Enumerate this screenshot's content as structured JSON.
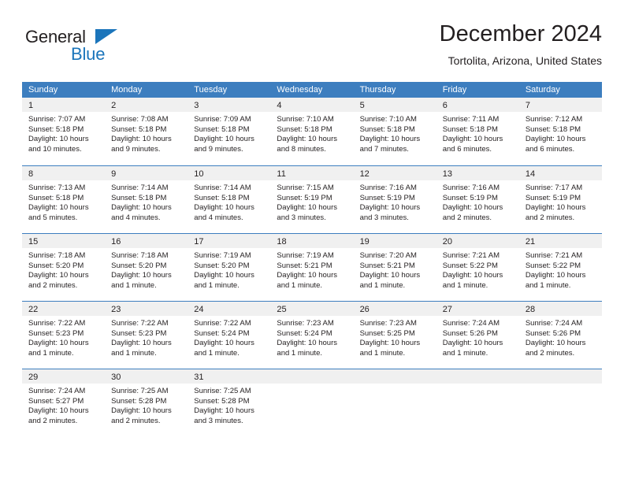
{
  "brand": {
    "name_top": "General",
    "name_bottom": "Blue",
    "triangle_icon": "blue-triangle-logo-icon",
    "color_black": "#231f20",
    "color_blue": "#1b75bb"
  },
  "header": {
    "title": "December 2024",
    "subtitle": "Tortolita, Arizona, United States"
  },
  "theme": {
    "header_bar": "#3d7ebf",
    "day_band": "#f0f0f0",
    "text": "#231f20",
    "background": "#ffffff"
  },
  "calendar": {
    "weekday_headers": [
      "Sunday",
      "Monday",
      "Tuesday",
      "Wednesday",
      "Thursday",
      "Friday",
      "Saturday"
    ],
    "weeks": [
      [
        {
          "day": "1",
          "lines": [
            "Sunrise: 7:07 AM",
            "Sunset: 5:18 PM",
            "Daylight: 10 hours",
            "and 10 minutes."
          ]
        },
        {
          "day": "2",
          "lines": [
            "Sunrise: 7:08 AM",
            "Sunset: 5:18 PM",
            "Daylight: 10 hours",
            "and 9 minutes."
          ]
        },
        {
          "day": "3",
          "lines": [
            "Sunrise: 7:09 AM",
            "Sunset: 5:18 PM",
            "Daylight: 10 hours",
            "and 9 minutes."
          ]
        },
        {
          "day": "4",
          "lines": [
            "Sunrise: 7:10 AM",
            "Sunset: 5:18 PM",
            "Daylight: 10 hours",
            "and 8 minutes."
          ]
        },
        {
          "day": "5",
          "lines": [
            "Sunrise: 7:10 AM",
            "Sunset: 5:18 PM",
            "Daylight: 10 hours",
            "and 7 minutes."
          ]
        },
        {
          "day": "6",
          "lines": [
            "Sunrise: 7:11 AM",
            "Sunset: 5:18 PM",
            "Daylight: 10 hours",
            "and 6 minutes."
          ]
        },
        {
          "day": "7",
          "lines": [
            "Sunrise: 7:12 AM",
            "Sunset: 5:18 PM",
            "Daylight: 10 hours",
            "and 6 minutes."
          ]
        }
      ],
      [
        {
          "day": "8",
          "lines": [
            "Sunrise: 7:13 AM",
            "Sunset: 5:18 PM",
            "Daylight: 10 hours",
            "and 5 minutes."
          ]
        },
        {
          "day": "9",
          "lines": [
            "Sunrise: 7:14 AM",
            "Sunset: 5:18 PM",
            "Daylight: 10 hours",
            "and 4 minutes."
          ]
        },
        {
          "day": "10",
          "lines": [
            "Sunrise: 7:14 AM",
            "Sunset: 5:18 PM",
            "Daylight: 10 hours",
            "and 4 minutes."
          ]
        },
        {
          "day": "11",
          "lines": [
            "Sunrise: 7:15 AM",
            "Sunset: 5:19 PM",
            "Daylight: 10 hours",
            "and 3 minutes."
          ]
        },
        {
          "day": "12",
          "lines": [
            "Sunrise: 7:16 AM",
            "Sunset: 5:19 PM",
            "Daylight: 10 hours",
            "and 3 minutes."
          ]
        },
        {
          "day": "13",
          "lines": [
            "Sunrise: 7:16 AM",
            "Sunset: 5:19 PM",
            "Daylight: 10 hours",
            "and 2 minutes."
          ]
        },
        {
          "day": "14",
          "lines": [
            "Sunrise: 7:17 AM",
            "Sunset: 5:19 PM",
            "Daylight: 10 hours",
            "and 2 minutes."
          ]
        }
      ],
      [
        {
          "day": "15",
          "lines": [
            "Sunrise: 7:18 AM",
            "Sunset: 5:20 PM",
            "Daylight: 10 hours",
            "and 2 minutes."
          ]
        },
        {
          "day": "16",
          "lines": [
            "Sunrise: 7:18 AM",
            "Sunset: 5:20 PM",
            "Daylight: 10 hours",
            "and 1 minute."
          ]
        },
        {
          "day": "17",
          "lines": [
            "Sunrise: 7:19 AM",
            "Sunset: 5:20 PM",
            "Daylight: 10 hours",
            "and 1 minute."
          ]
        },
        {
          "day": "18",
          "lines": [
            "Sunrise: 7:19 AM",
            "Sunset: 5:21 PM",
            "Daylight: 10 hours",
            "and 1 minute."
          ]
        },
        {
          "day": "19",
          "lines": [
            "Sunrise: 7:20 AM",
            "Sunset: 5:21 PM",
            "Daylight: 10 hours",
            "and 1 minute."
          ]
        },
        {
          "day": "20",
          "lines": [
            "Sunrise: 7:21 AM",
            "Sunset: 5:22 PM",
            "Daylight: 10 hours",
            "and 1 minute."
          ]
        },
        {
          "day": "21",
          "lines": [
            "Sunrise: 7:21 AM",
            "Sunset: 5:22 PM",
            "Daylight: 10 hours",
            "and 1 minute."
          ]
        }
      ],
      [
        {
          "day": "22",
          "lines": [
            "Sunrise: 7:22 AM",
            "Sunset: 5:23 PM",
            "Daylight: 10 hours",
            "and 1 minute."
          ]
        },
        {
          "day": "23",
          "lines": [
            "Sunrise: 7:22 AM",
            "Sunset: 5:23 PM",
            "Daylight: 10 hours",
            "and 1 minute."
          ]
        },
        {
          "day": "24",
          "lines": [
            "Sunrise: 7:22 AM",
            "Sunset: 5:24 PM",
            "Daylight: 10 hours",
            "and 1 minute."
          ]
        },
        {
          "day": "25",
          "lines": [
            "Sunrise: 7:23 AM",
            "Sunset: 5:24 PM",
            "Daylight: 10 hours",
            "and 1 minute."
          ]
        },
        {
          "day": "26",
          "lines": [
            "Sunrise: 7:23 AM",
            "Sunset: 5:25 PM",
            "Daylight: 10 hours",
            "and 1 minute."
          ]
        },
        {
          "day": "27",
          "lines": [
            "Sunrise: 7:24 AM",
            "Sunset: 5:26 PM",
            "Daylight: 10 hours",
            "and 1 minute."
          ]
        },
        {
          "day": "28",
          "lines": [
            "Sunrise: 7:24 AM",
            "Sunset: 5:26 PM",
            "Daylight: 10 hours",
            "and 2 minutes."
          ]
        }
      ],
      [
        {
          "day": "29",
          "lines": [
            "Sunrise: 7:24 AM",
            "Sunset: 5:27 PM",
            "Daylight: 10 hours",
            "and 2 minutes."
          ]
        },
        {
          "day": "30",
          "lines": [
            "Sunrise: 7:25 AM",
            "Sunset: 5:28 PM",
            "Daylight: 10 hours",
            "and 2 minutes."
          ]
        },
        {
          "day": "31",
          "lines": [
            "Sunrise: 7:25 AM",
            "Sunset: 5:28 PM",
            "Daylight: 10 hours",
            "and 3 minutes."
          ]
        },
        {
          "day": "",
          "lines": []
        },
        {
          "day": "",
          "lines": []
        },
        {
          "day": "",
          "lines": []
        },
        {
          "day": "",
          "lines": []
        }
      ]
    ]
  }
}
